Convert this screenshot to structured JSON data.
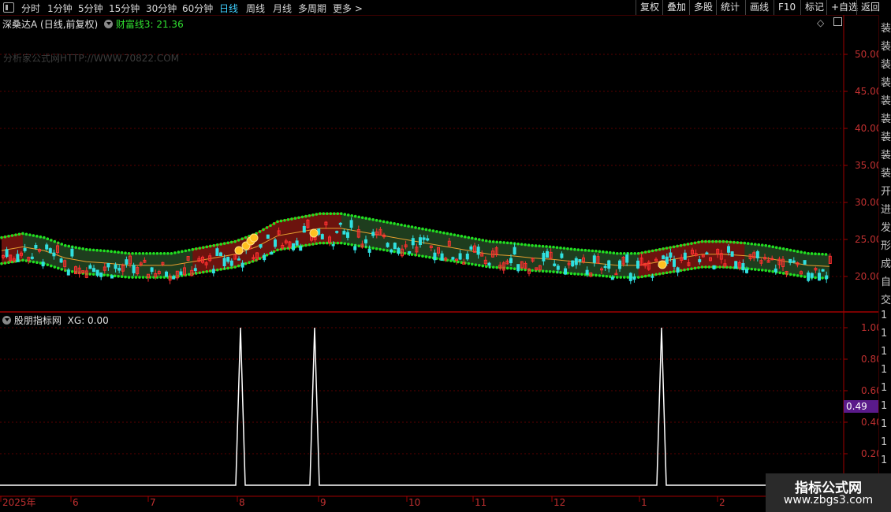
{
  "toolbar": {
    "periods": [
      "分时",
      "1分钟",
      "5分钟",
      "15分钟",
      "30分钟",
      "60分钟",
      "日线",
      "周线",
      "月线",
      "多周期",
      "更多 >"
    ],
    "active_period": "日线",
    "right_buttons": [
      "复权",
      "叠加",
      "多股",
      "统计",
      "画线",
      "F10",
      "标记",
      "+自选",
      "返回"
    ]
  },
  "main_panel": {
    "stock_title": "深桑达A (日线,前复权)",
    "indicator_label": "财富线3: 21.36",
    "watermark": "分析家公式网HTTP://WWW.70822.COM",
    "y_ticks": [
      "50.00",
      "45.00",
      "40.00",
      "35.00",
      "30.00",
      "25.00",
      "20.00"
    ]
  },
  "sub_panel": {
    "title": "股朋指标网",
    "xg_label": "XG: 0.00",
    "y_ticks": [
      "1.00",
      "0.80",
      "0.60",
      "0.40",
      "0.20"
    ],
    "current_value_badge": "0.49"
  },
  "x_axis": {
    "labels": [
      "2025年",
      "6",
      "7",
      "8",
      "9",
      "10",
      "11",
      "12",
      "1",
      "2"
    ]
  },
  "right_edge_chars": [
    "装",
    "装",
    "装",
    "装",
    "装",
    "装",
    "装",
    "装",
    "装",
    "开",
    "进",
    "发",
    "形",
    "成",
    "自",
    "交",
    "1",
    "1",
    "1",
    "1",
    "1",
    "1",
    "1",
    "1",
    "1"
  ],
  "logo": {
    "line1": "指标公式网",
    "line2": "www.zbgs3.com"
  },
  "colors": {
    "band_upper": "#21e021",
    "band_lower_red": "#e01010",
    "band_fill": "#1e3d1e",
    "mid_line": "#e8a030",
    "candle_up": "#ff3030",
    "candle_down": "#30e0e0",
    "axis_red": "#a00000",
    "active_tab": "#3fd0ff"
  },
  "chart_data": [
    {
      "type": "candlestick",
      "title": "深桑达A (日线,前复权)",
      "series": [
        {
          "name": "财富线3",
          "values": [
            23.5,
            24.0,
            23.5,
            22.5,
            22.0,
            21.8,
            21.5,
            21.5,
            21.5,
            22.0,
            22.5,
            23.0,
            24.0,
            25.5,
            26.0,
            26.5,
            26.5,
            26.0,
            25.5,
            25.0,
            24.5,
            24.0,
            23.5,
            23.0,
            22.8,
            22.5,
            22.3,
            22.0,
            21.8,
            21.5,
            21.5,
            22.0,
            22.5,
            23.0,
            23.0,
            22.8,
            22.5,
            22.0,
            21.5,
            21.36
          ]
        }
      ],
      "ylim": [
        17.0,
        53.0
      ]
    },
    {
      "type": "line",
      "title": "股朋指标网",
      "series": [
        {
          "name": "XG",
          "x": [
            "2025-08-01",
            "2025-09-01",
            "2026-01-10"
          ],
          "values": [
            1.0,
            1.0,
            1.0
          ]
        }
      ],
      "ylim": [
        0.0,
        1.0
      ]
    }
  ]
}
